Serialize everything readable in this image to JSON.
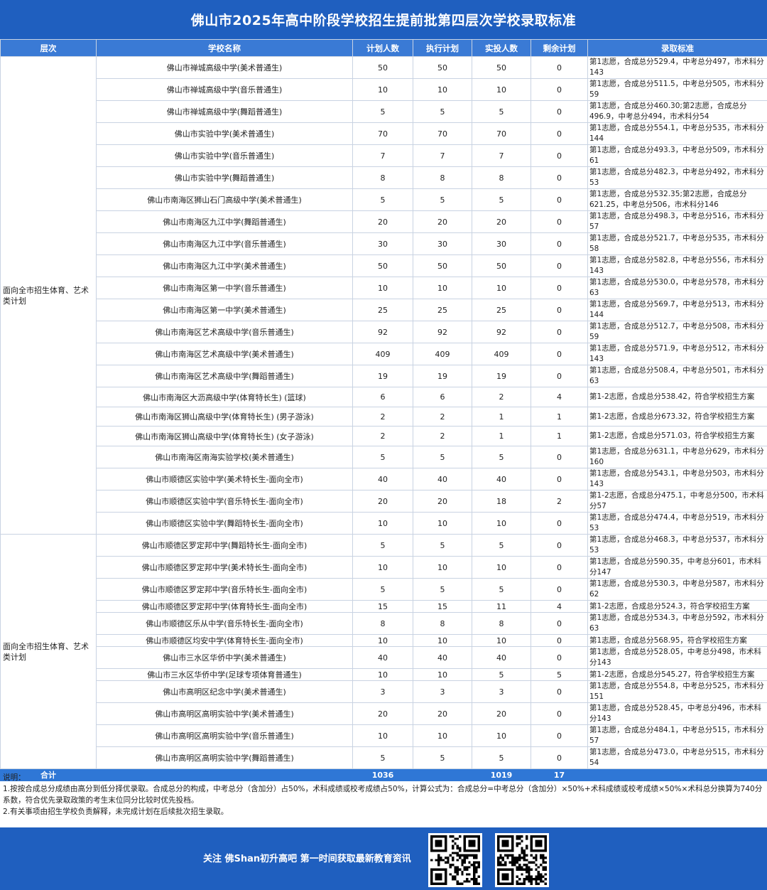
{
  "title": "佛山市2025年高中阶段学校招生提前批第四层次学校录取标准",
  "table": {
    "headers": [
      "层次",
      "学校名称",
      "计划人数",
      "执行计划",
      "实投人数",
      "剩余计划",
      "录取标准"
    ],
    "groups": [
      {
        "label": "面向全市招生体育、艺术类计划",
        "rows": [
          {
            "school": "佛山市禅城高级中学(美术普通生)",
            "plan": "50",
            "exec": "50",
            "actual": "50",
            "remain": "0",
            "standard": "第1志愿，合成总分529.4，中考总分497，市术科分143",
            "h": 31
          },
          {
            "school": "佛山市禅城高级中学(音乐普通生)",
            "plan": "10",
            "exec": "10",
            "actual": "10",
            "remain": "0",
            "standard": "第1志愿，合成总分511.5，中考总分505，市术科分59",
            "h": 31
          },
          {
            "school": "佛山市禅城高级中学(舞蹈普通生)",
            "plan": "5",
            "exec": "5",
            "actual": "5",
            "remain": "0",
            "standard": "第1志愿，合成总分460.30;第2志愿，合成总分496.9，中考总分494，市术科分54",
            "h": 31
          },
          {
            "school": "佛山市实验中学(美术普通生)",
            "plan": "70",
            "exec": "70",
            "actual": "70",
            "remain": "0",
            "standard": "第1志愿，合成总分554.1，中考总分535，市术科分144",
            "h": 30
          },
          {
            "school": "佛山市实验中学(音乐普通生)",
            "plan": "7",
            "exec": "7",
            "actual": "7",
            "remain": "0",
            "standard": "第1志愿，合成总分493.3，中考总分509，市术科分61",
            "h": 31
          },
          {
            "school": "佛山市实验中学(舞蹈普通生)",
            "plan": "8",
            "exec": "8",
            "actual": "8",
            "remain": "0",
            "standard": "第1志愿，合成总分482.3，中考总分492，市术科分53",
            "h": 30
          },
          {
            "school": "佛山市南海区狮山石门高级中学(美术普通生)",
            "plan": "5",
            "exec": "5",
            "actual": "5",
            "remain": "0",
            "standard": "第1志愿，合成总分532.35;第2志愿，合成总分621.25，中考总分506，市术科分146",
            "h": 31
          },
          {
            "school": "佛山市南海区九江中学(舞蹈普通生)",
            "plan": "20",
            "exec": "20",
            "actual": "20",
            "remain": "0",
            "standard": "第1志愿，合成总分498.3，中考总分516，市术科分57",
            "h": 30
          },
          {
            "school": "佛山市南海区九江中学(音乐普通生)",
            "plan": "30",
            "exec": "30",
            "actual": "30",
            "remain": "0",
            "standard": "第1志愿，合成总分521.7，中考总分535，市术科分58",
            "h": 31
          },
          {
            "school": "佛山市南海区九江中学(美术普通生)",
            "plan": "50",
            "exec": "50",
            "actual": "50",
            "remain": "0",
            "standard": "第1志愿，合成总分582.8，中考总分556，市术科分143",
            "h": 30
          },
          {
            "school": "佛山市南海区第一中学(音乐普通生)",
            "plan": "10",
            "exec": "10",
            "actual": "10",
            "remain": "0",
            "standard": "第1志愿，合成总分530.0，中考总分578，市术科分63",
            "h": 31
          },
          {
            "school": "佛山市南海区第一中学(美术普通生)",
            "plan": "25",
            "exec": "25",
            "actual": "25",
            "remain": "0",
            "standard": "第1志愿，合成总分569.7，中考总分513，市术科分144",
            "h": 30
          },
          {
            "school": "佛山市南海区艺术高级中学(音乐普通生)",
            "plan": "92",
            "exec": "92",
            "actual": "92",
            "remain": "0",
            "standard": "第1志愿，合成总分512.7，中考总分508，市术科分59",
            "h": 31
          },
          {
            "school": "佛山市南海区艺术高级中学(美术普通生)",
            "plan": "409",
            "exec": "409",
            "actual": "409",
            "remain": "0",
            "standard": "第1志愿，合成总分571.9，中考总分512，市术科分143",
            "h": 30
          },
          {
            "school": "佛山市南海区艺术高级中学(舞蹈普通生)",
            "plan": "19",
            "exec": "19",
            "actual": "19",
            "remain": "0",
            "standard": "第1志愿，合成总分508.4，中考总分501，市术科分63",
            "h": 31
          },
          {
            "school": "佛山市南海区大沥高级中学(体育特长生) (篮球)",
            "plan": "6",
            "exec": "6",
            "actual": "2",
            "remain": "4",
            "standard": "第1-2志愿，合成总分538.42，符合学校招生方案",
            "h": 28
          },
          {
            "school": "佛山市南海区狮山高级中学(体育特长生) (男子游泳)",
            "plan": "2",
            "exec": "2",
            "actual": "1",
            "remain": "1",
            "standard": "第1-2志愿，合成总分673.32，符合学校招生方案",
            "h": 27
          },
          {
            "school": "佛山市南海区狮山高级中学(体育特长生) (女子游泳)",
            "plan": "2",
            "exec": "2",
            "actual": "1",
            "remain": "1",
            "standard": "第1-2志愿，合成总分571.03，符合学校招生方案",
            "h": 28
          },
          {
            "school": "佛山市南海区南海实验学校(美术普通生)",
            "plan": "5",
            "exec": "5",
            "actual": "5",
            "remain": "0",
            "standard": "第1志愿，合成总分631.1，中考总分629，市术科分160",
            "h": 31
          },
          {
            "school": "佛山市顺德区实验中学(美术特长生-面向全市)",
            "plan": "40",
            "exec": "40",
            "actual": "40",
            "remain": "0",
            "standard": "第1志愿，合成总分543.1，中考总分503，市术科分143",
            "h": 30
          },
          {
            "school": "佛山市顺德区实验中学(音乐特长生-面向全市)",
            "plan": "20",
            "exec": "20",
            "actual": "18",
            "remain": "2",
            "standard": "第1-2志愿，合成总分475.1，中考总分500，市术科分57",
            "h": 31
          },
          {
            "school": "佛山市顺德区实验中学(舞蹈特长生-面向全市)",
            "plan": "10",
            "exec": "10",
            "actual": "10",
            "remain": "0",
            "standard": "第1志愿，合成总分474.4，中考总分519，市术科分53",
            "h": 30
          }
        ]
      },
      {
        "label": "面向全市招生体育、艺术类计划",
        "rows": [
          {
            "school": "佛山市顺德区罗定邦中学(舞蹈特长生-面向全市)",
            "plan": "5",
            "exec": "5",
            "actual": "5",
            "remain": "0",
            "standard": "第1志愿，合成总分468.3，中考总分537，市术科分53",
            "h": 31
          },
          {
            "school": "佛山市顺德区罗定邦中学(美术特长生-面向全市)",
            "plan": "10",
            "exec": "10",
            "actual": "10",
            "remain": "0",
            "standard": "第1志愿，合成总分590.35，中考总分601，市术科分147",
            "h": 30
          },
          {
            "school": "佛山市顺德区罗定邦中学(音乐特长生-面向全市)",
            "plan": "5",
            "exec": "5",
            "actual": "5",
            "remain": "0",
            "standard": "第1志愿，合成总分530.3，中考总分587，市术科分62",
            "h": 31
          },
          {
            "school": "佛山市顺德区罗定邦中学(体育特长生-面向全市)",
            "plan": "15",
            "exec": "15",
            "actual": "11",
            "remain": "4",
            "standard": "第1-2志愿，合成总分524.3，符合学校招生方案",
            "h": 15
          },
          {
            "school": "佛山市顺德区乐从中学(音乐特长生-面向全市)",
            "plan": "8",
            "exec": "8",
            "actual": "8",
            "remain": "0",
            "standard": "第1志愿，合成总分534.3，中考总分592，市术科分63",
            "h": 31
          },
          {
            "school": "佛山市顺德区均安中学(体育特长生-面向全市)",
            "plan": "10",
            "exec": "10",
            "actual": "10",
            "remain": "0",
            "standard": "第1志愿，合成总分568.95，符合学校招生方案",
            "h": 15
          },
          {
            "school": "佛山市三水区华侨中学(美术普通生)",
            "plan": "40",
            "exec": "40",
            "actual": "40",
            "remain": "0",
            "standard": "第1志愿，合成总分528.05，中考总分498，市术科分143",
            "h": 31
          },
          {
            "school": "佛山市三水区华侨中学(足球专项体育普通生)",
            "plan": "10",
            "exec": "10",
            "actual": "5",
            "remain": "5",
            "standard": "第1-2志愿，合成总分545.27，符合学校招生方案",
            "h": 15
          },
          {
            "school": "佛山市高明区纪念中学(美术普通生)",
            "plan": "3",
            "exec": "3",
            "actual": "3",
            "remain": "0",
            "standard": "第1志愿，合成总分554.8，中考总分525，市术科分151",
            "h": 31
          },
          {
            "school": "佛山市高明区高明实验中学(美术普通生)",
            "plan": "20",
            "exec": "20",
            "actual": "20",
            "remain": "0",
            "standard": "第1志愿，合成总分528.45，中考总分496，市术科分143",
            "h": 30
          },
          {
            "school": "佛山市高明区高明实验中学(音乐普通生)",
            "plan": "10",
            "exec": "10",
            "actual": "10",
            "remain": "0",
            "standard": "第1志愿，合成总分484.1，中考总分515，市术科分57",
            "h": 31
          },
          {
            "school": "佛山市高明区高明实验中学(舞蹈普通生)",
            "plan": "5",
            "exec": "5",
            "actual": "5",
            "remain": "0",
            "standard": "第1志愿，合成总分473.0，中考总分515，市术科分54",
            "h": 30
          }
        ]
      }
    ],
    "total": {
      "label": "合计",
      "plan": "1036",
      "exec": "",
      "actual": "1019",
      "remain": "17",
      "standard": ""
    }
  },
  "notes": {
    "heading": "说明：",
    "line1": "1.按按合成总分成绩由高分到低分择优录取。合成总分的构成，中考总分（含加分）占50%，术科成绩或校考成绩占50%，计算公式为：合成总分=中考总分（含加分）×50%+术科成绩或校考成绩×50%×术科总分换算为740分系数，符合优先录取政策的考生末位同分比较时优先投档。",
    "line2": "2.有关事项由招生学校负责解释，未完成计划在后续批次招生录取。"
  },
  "footer": {
    "text": "关注 佛Shan初升高吧    第一时间获取最新教育资讯",
    "qr1_icon": "qr-code-icon",
    "qr2_icon": "qr-code-icon"
  }
}
